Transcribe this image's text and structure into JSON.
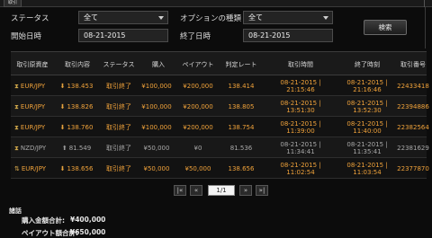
{
  "tab": {
    "label": "取引"
  },
  "filters": {
    "status_label": "ステータス",
    "status_value": "全て",
    "option_type_label": "オプションの種類",
    "option_type_value": "全て",
    "start_date_label": "開始日時",
    "start_date_value": "08-21-2015",
    "end_date_label": "終了日時",
    "end_date_value": "08-21-2015",
    "search_label": "検索"
  },
  "table": {
    "headers": [
      "取引原資産",
      "取引内容",
      "ステータス",
      "購入",
      "ペイアウト",
      "判定レート",
      "取引時間",
      "終了時刻",
      "取引番号"
    ],
    "rows": [
      {
        "icon": "hourglass-icon",
        "asset": "EUR/JPY",
        "dir": "down",
        "rate": "138.453",
        "status": "取引終了",
        "purchase": "¥100,000",
        "payout": "¥200,000",
        "judge": "138.414",
        "time1": "08-21-2015 |",
        "time2": "21:15:46",
        "end1": "08-21-2015 |",
        "end2": "21:16:46",
        "id": "22433418",
        "highlight": true
      },
      {
        "icon": "hourglass-icon",
        "asset": "EUR/JPY",
        "dir": "down",
        "rate": "138.826",
        "status": "取引終了",
        "purchase": "¥100,000",
        "payout": "¥200,000",
        "judge": "138.805",
        "time1": "08-21-2015 |",
        "time2": "13:51:30",
        "end1": "08-21-2015 |",
        "end2": "13:52:30",
        "id": "22394886",
        "highlight": true
      },
      {
        "icon": "hourglass-icon",
        "asset": "EUR/JPY",
        "dir": "down",
        "rate": "138.760",
        "status": "取引終了",
        "purchase": "¥100,000",
        "payout": "¥200,000",
        "judge": "138.754",
        "time1": "08-21-2015 |",
        "time2": "11:39:00",
        "end1": "08-21-2015 |",
        "end2": "11:40:00",
        "id": "22382564",
        "highlight": true
      },
      {
        "icon": "hourglass-icon",
        "asset": "NZD/JPY",
        "dir": "up",
        "rate": "81.549",
        "status": "取引終了",
        "purchase": "¥50,000",
        "payout": "¥0",
        "judge": "81.536",
        "time1": "08-21-2015 |",
        "time2": "11:34:41",
        "end1": "08-21-2015 |",
        "end2": "11:35:41",
        "id": "22381629",
        "highlight": false
      },
      {
        "icon": "updown-icon",
        "asset": "EUR/JPY",
        "dir": "down",
        "rate": "138.656",
        "status": "取引終了",
        "purchase": "¥50,000",
        "payout": "¥50,000",
        "judge": "138.656",
        "time1": "08-21-2015 |",
        "time2": "11:02:54",
        "end1": "08-21-2015 |",
        "end2": "11:03:54",
        "id": "22377870",
        "highlight": true
      }
    ]
  },
  "pagination": {
    "first": "|«",
    "prev": "«",
    "page": "1/1",
    "next": "»",
    "last": "»|"
  },
  "summary": {
    "title": "諸話",
    "purchase_label": "購入金額合計:",
    "purchase_value": "¥400,000",
    "payout_label": "ペイアウト額合計:",
    "payout_value": "¥650,000"
  },
  "colors": {
    "accent": "#f0a23a",
    "muted": "#a8a8a8",
    "background": "#0c0c0c"
  }
}
